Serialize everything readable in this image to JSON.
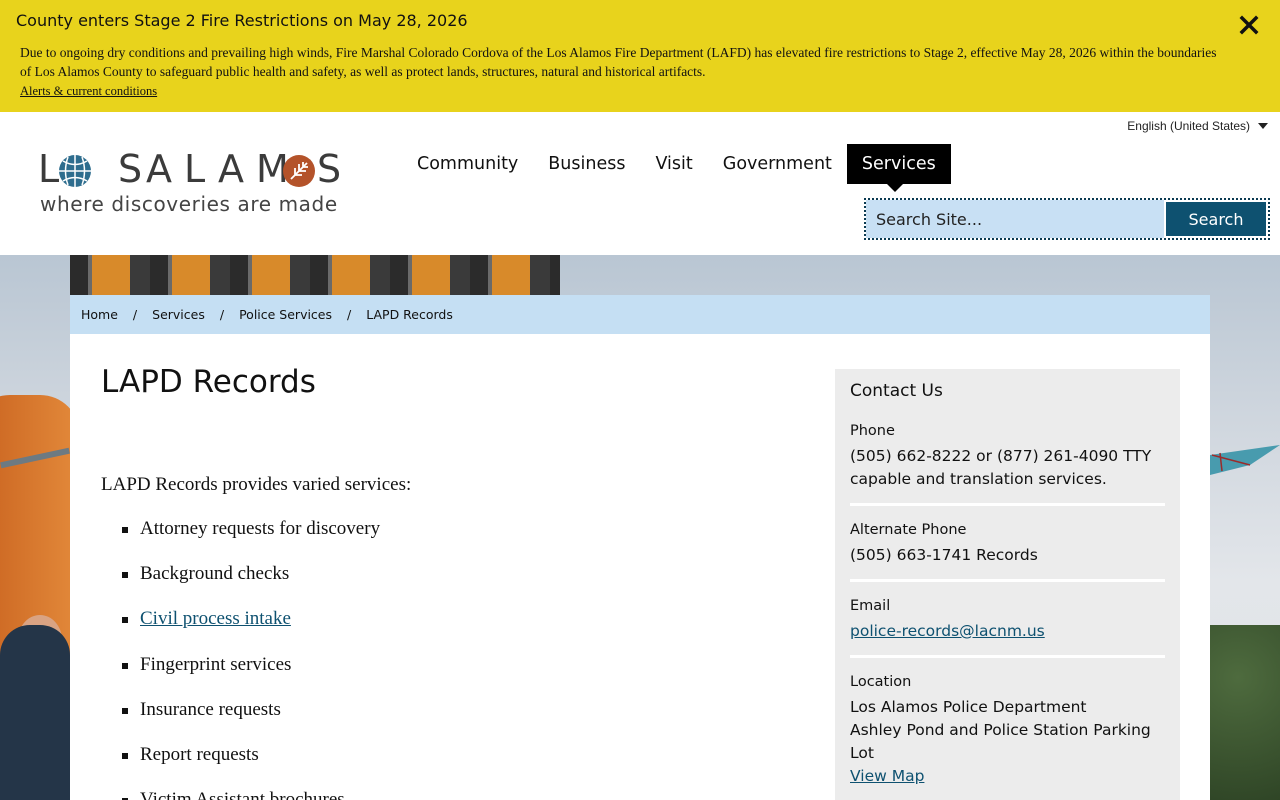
{
  "alert": {
    "title": "County enters Stage 2 Fire Restrictions on May 28, 2026",
    "body": "Due to ongoing dry conditions and prevailing high winds, Fire Marshal Colorado Cordova of the Los Alamos Fire Department (LAFD) has elevated fire restrictions to Stage 2, effective May 28, 2026 within the boundaries of Los Alamos County to safeguard public health and safety, as well as protect lands, structures, natural and historical artifacts.",
    "link_label": "Alerts & current conditions",
    "background_color": "#e8d31c"
  },
  "language": {
    "selected": "English (United States)"
  },
  "logo": {
    "wordmark": "LOS ALAMOS",
    "tagline": "where discoveries are made"
  },
  "nav": {
    "items": [
      {
        "label": "Community"
      },
      {
        "label": "Business"
      },
      {
        "label": "Visit"
      },
      {
        "label": "Government"
      },
      {
        "label": "Services",
        "active": true
      }
    ]
  },
  "search": {
    "placeholder": "Search Site...",
    "button_label": "Search",
    "accent_color": "#0e5170"
  },
  "breadcrumb": [
    "Home",
    "Services",
    "Police Services",
    "LAPD Records"
  ],
  "main": {
    "title": "LAPD Records",
    "intro": "LAPD Records provides varied services:",
    "services": [
      {
        "label": "Attorney requests for discovery"
      },
      {
        "label": "Background checks"
      },
      {
        "label": "Civil process intake",
        "link": true
      },
      {
        "label": "Fingerprint services"
      },
      {
        "label": "Insurance requests"
      },
      {
        "label": "Report requests"
      },
      {
        "label": "Victim Assistant brochures"
      }
    ]
  },
  "contact": {
    "heading": "Contact Us",
    "phone_label": "Phone",
    "phone_value": "(505) 662-8222 or (877) 261-4090 TTY capable and translation services.",
    "alt_phone_label": "Alternate Phone",
    "alt_phone_value": "(505) 663-1741 Records",
    "email_label": "Email",
    "email_value": "police-records@lacnm.us",
    "location_label": "Location",
    "location_line1": "Los Alamos Police Department",
    "location_line2": "Ashley Pond and Police Station Parking Lot",
    "map_link": "View Map"
  }
}
